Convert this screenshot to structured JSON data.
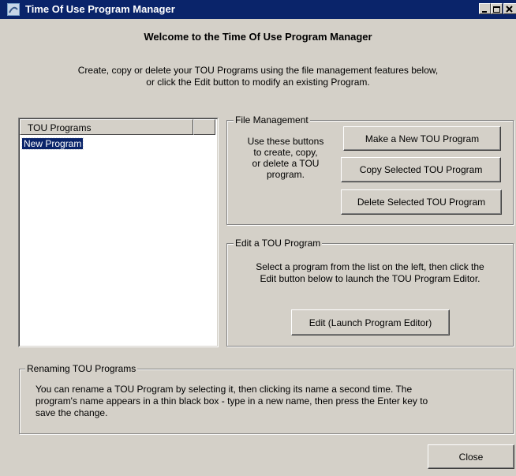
{
  "window": {
    "title": "Time Of Use Program Manager"
  },
  "header": {
    "welcome": "Welcome to the Time Of Use Program Manager",
    "intro_line1": "Create, copy or delete your TOU Programs using the file management features below,",
    "intro_line2": "or click the Edit button to modify an existing Program."
  },
  "program_list": {
    "column_header": "TOU Programs",
    "items": [
      {
        "label": "New Program",
        "selected": true
      }
    ]
  },
  "file_management": {
    "legend": "File Management",
    "help_line1": "Use these buttons",
    "help_line2": "to create, copy,",
    "help_line3": "or delete a TOU",
    "help_line4": "program.",
    "make_button": "Make a New TOU Program",
    "copy_button": "Copy Selected TOU Program",
    "delete_button": "Delete Selected TOU Program"
  },
  "edit_program": {
    "legend": "Edit a TOU Program",
    "help_line1": "Select a program from the list on the left, then click the",
    "help_line2": "Edit button below to launch the TOU Program Editor.",
    "edit_button": "Edit (Launch Program Editor)"
  },
  "renaming": {
    "legend": "Renaming TOU Programs",
    "line1": "You can rename a TOU Program by selecting it, then clicking its name a second time. The",
    "line2": "program's name appears in a thin black box - type in a new name, then press the Enter key to",
    "line3": "save the change."
  },
  "footer": {
    "close_button": "Close"
  },
  "colors": {
    "titlebar": "#0a246a",
    "dialog_face": "#d4d0c8",
    "selection": "#0a246a"
  }
}
